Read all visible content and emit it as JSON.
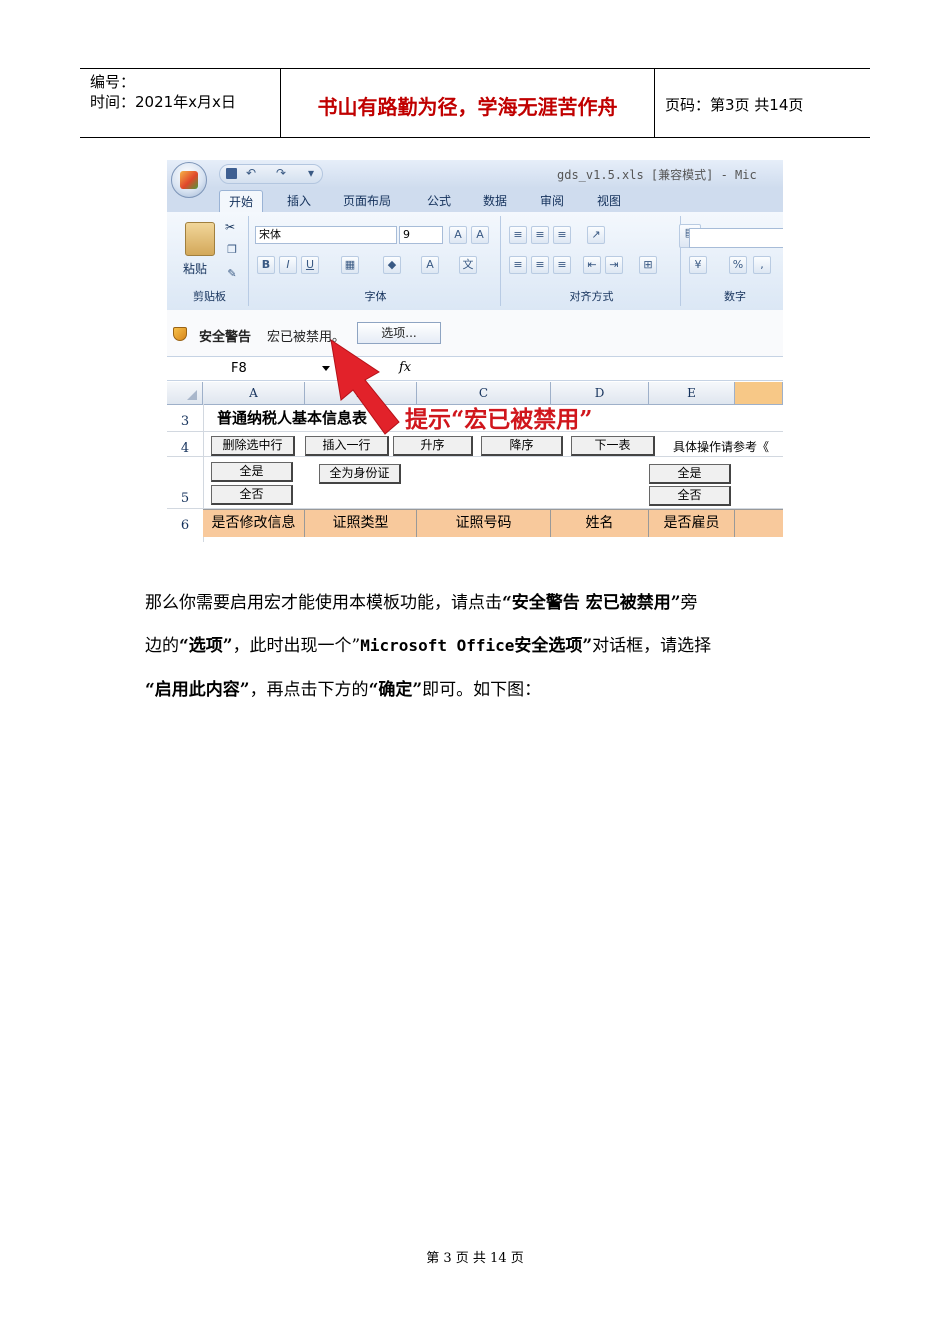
{
  "header": {
    "number_label": "编号：",
    "date_label": "时间：2021年x月x日",
    "motto": "书山有路勤为径，学海无涯苦作舟",
    "page_label": "页码：第3页  共14页"
  },
  "screenshot": {
    "window_title": "gds_v1.5.xls  [兼容模式] - Mic",
    "tabs": [
      "开始",
      "插入",
      "页面布局",
      "公式",
      "数据",
      "审阅",
      "视图"
    ],
    "groups": {
      "clipboard": "剪贴板",
      "font": "字体",
      "align": "对齐方式",
      "number": "数字"
    },
    "paste_label": "粘贴",
    "font_name": "宋体",
    "font_size": "9",
    "security_warning": "安全警告",
    "macro_disabled": "宏已被禁用。",
    "options_button": "选项...",
    "name_box": "F8",
    "fx_label": "fx",
    "columns": [
      "A",
      "B",
      "C",
      "D",
      "E"
    ],
    "rows": [
      "3",
      "4",
      "5",
      "6"
    ],
    "sheet_title": "普通纳税人基本信息表",
    "hint_text": "提示“宏已被禁用”",
    "buttons": {
      "delete_row": "删除选中行",
      "insert_row": "插入一行",
      "ascending": "升序",
      "descending": "降序",
      "next_table": "下一表",
      "all_yes_left": "全是",
      "all_no_left": "全否",
      "all_id": "全为身份证",
      "all_yes_right": "全是",
      "all_no_right": "全否"
    },
    "refer_text": "具体操作请参考《",
    "table_headers": [
      "是否修改信息",
      "证照类型",
      "证照号码",
      "姓名",
      "是否雇员"
    ]
  },
  "paragraph": {
    "l1_a": "那么你需要启用宏才能使用本模板功能，请点击",
    "l1_b": "“安全警告  宏已被禁用”",
    "l1_c": "旁",
    "l2_a": "边的",
    "l2_b": "“选项”",
    "l2_c": "，此时出现一个”",
    "l2_d": "Microsoft Office",
    "l2_e": "安全选项”",
    "l2_f": "对话框，请选择",
    "l3_a": "“启用此内容”",
    "l3_b": "，再点击下方的",
    "l3_c": "“确定”",
    "l3_d": "即可。如下图："
  },
  "footer": {
    "text": "第 3 页 共 14 页"
  }
}
